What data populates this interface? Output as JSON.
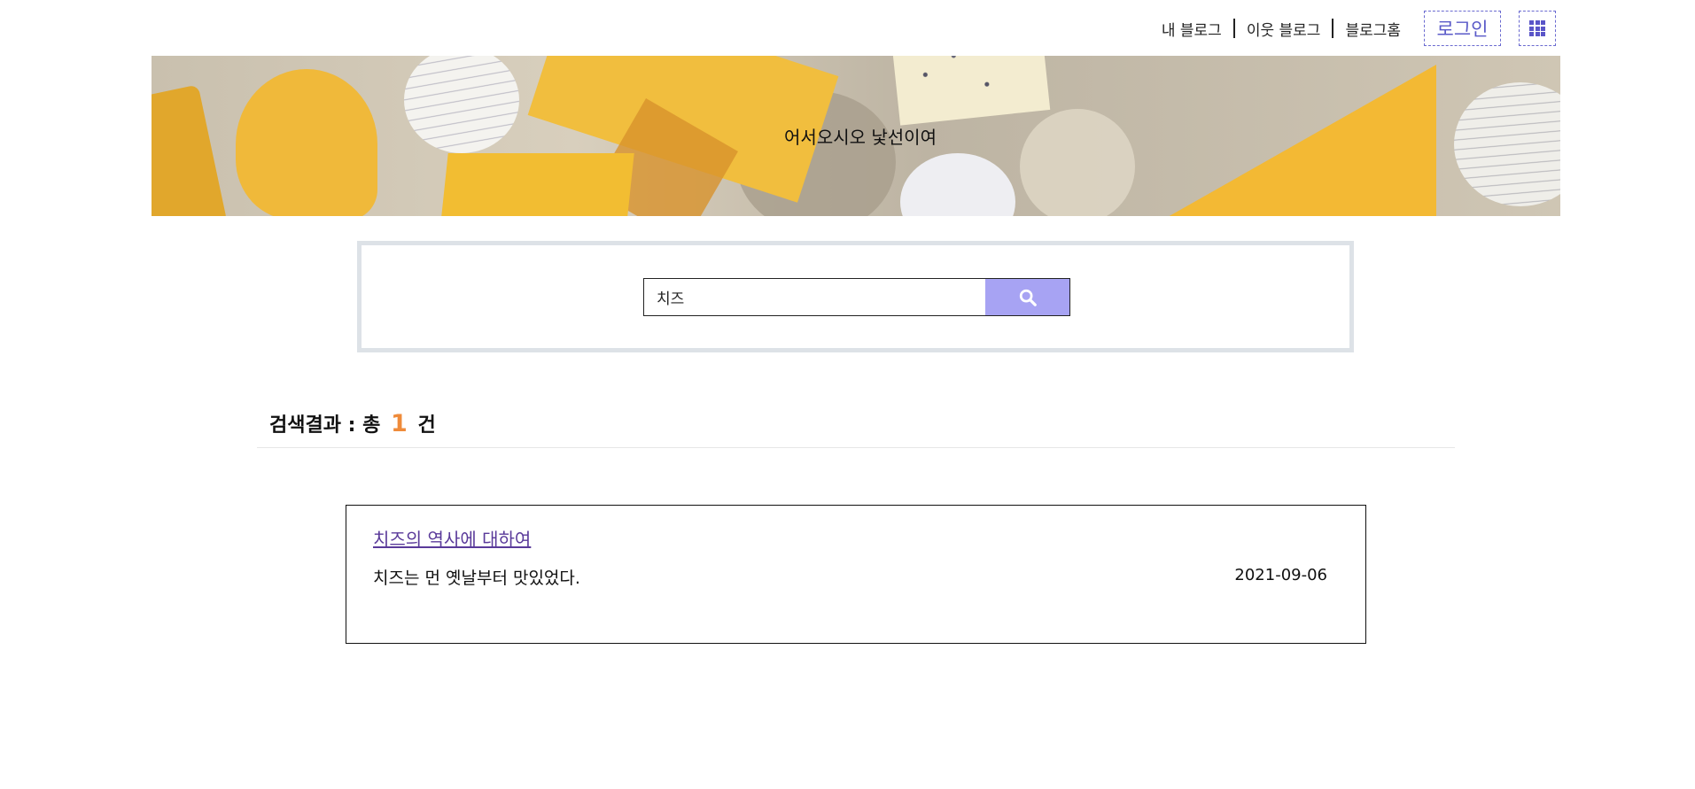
{
  "topnav": {
    "my_blog": "내 블로그",
    "neighbor_blog": "이웃 블로그",
    "blog_home": "블로그홈",
    "login": "로그인",
    "menu_icon": "grid-icon"
  },
  "banner": {
    "title": "어서오시오 낯선이여"
  },
  "search": {
    "query": "치즈",
    "button_icon": "search-icon",
    "accent_color": "#a7a3f3"
  },
  "results": {
    "label_prefix": "검색결과 : 총",
    "count": "1",
    "label_suffix": "건",
    "items": [
      {
        "title": "치즈의 역사에 대하여",
        "snippet": "치즈는 먼 옛날부터 맛있었다.",
        "date": "2021-09-06"
      }
    ]
  },
  "colors": {
    "count_highlight": "#ef8b3a",
    "link": "#5a3a9a",
    "login_accent": "#5a5ac8"
  }
}
